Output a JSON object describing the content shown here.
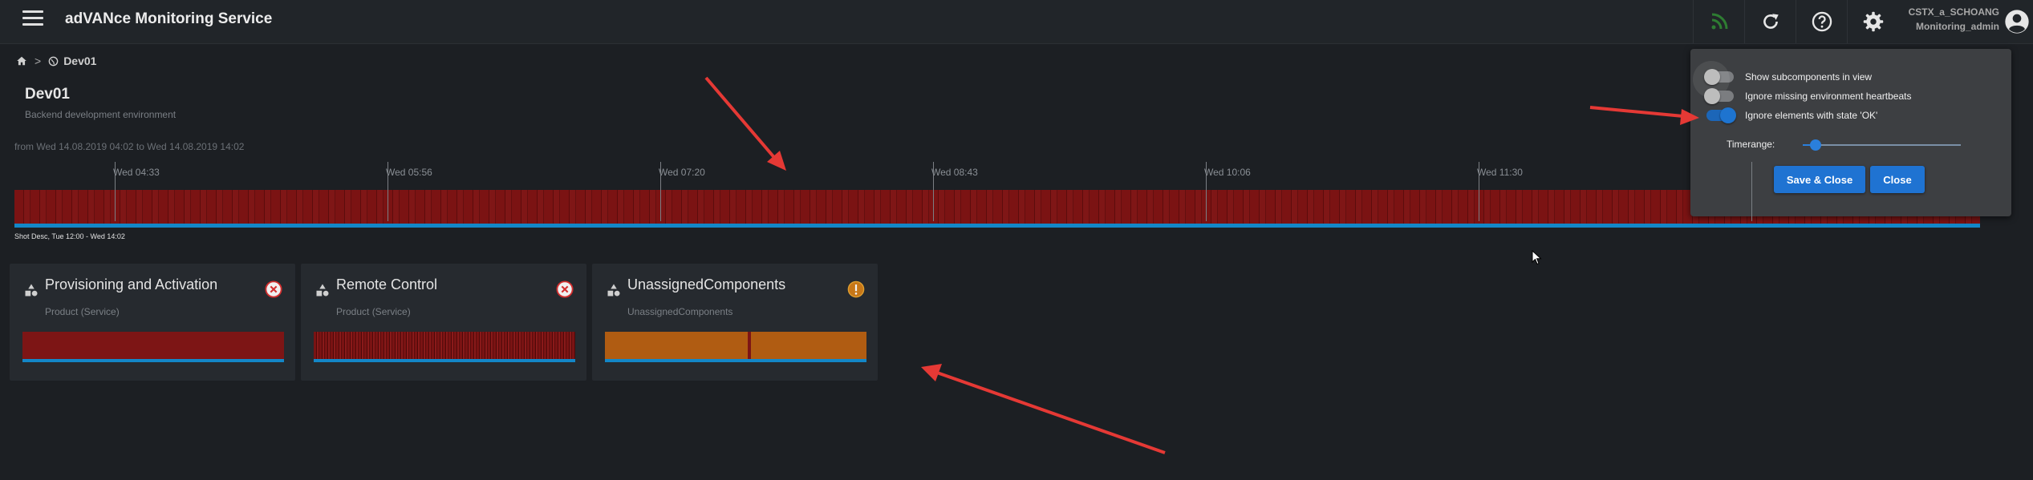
{
  "app": {
    "title": "adVANce Monitoring Service"
  },
  "header": {
    "user_name": "CSTX_a_SCHOANG",
    "user_role": "Monitoring_admin",
    "icons": [
      "rss-icon",
      "refresh-icon",
      "help-icon",
      "gear-icon",
      "user-icon"
    ],
    "rss_color": "#2e7d32"
  },
  "breadcrumb": {
    "separator": ">",
    "current": "Dev01"
  },
  "environment": {
    "title": "Dev01",
    "description": "Backend development environment",
    "range_text": "from Wed 14.08.2019 04:02 to Wed 14.08.2019 14:02"
  },
  "timeline": {
    "ticks": [
      "Wed 04:33",
      "Wed 05:56",
      "Wed 07:20",
      "Wed 08:43",
      "Wed 10:06",
      "Wed 11:30"
    ],
    "shot_label": "Shot Desc, Tue 12:00 - Wed 14:02",
    "status_color": "#7b1313",
    "accent_color": "#1387c7"
  },
  "cards": [
    {
      "title": "Provisioning and Activation",
      "subtitle": "Product (Service)",
      "status": "error"
    },
    {
      "title": "Remote Control",
      "subtitle": "Product (Service)",
      "status": "error"
    },
    {
      "title": "UnassignedComponents",
      "subtitle": "UnassignedComponents",
      "status": "warning"
    }
  ],
  "settings_panel": {
    "toggles": [
      {
        "label": "Show subcomponents in view",
        "on": false
      },
      {
        "label": "Ignore missing environment heartbeats",
        "on": false
      },
      {
        "label": "Ignore elements with state 'OK'",
        "on": true
      }
    ],
    "timerange_label": "Timerange:",
    "timerange_value": 0.08,
    "save_label": "Save & Close",
    "close_label": "Close"
  },
  "colors": {
    "error": "#c62828",
    "warning": "#d0821a",
    "primary": "#1f73d2",
    "annotation_arrow": "#e53935"
  }
}
